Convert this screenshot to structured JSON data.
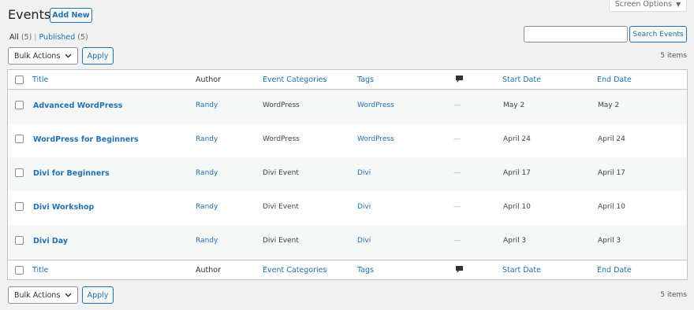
{
  "page": {
    "title": "Events",
    "add_new": "Add New",
    "screen_options": "Screen Options",
    "screen_options_arrow": "▼"
  },
  "views": {
    "all_label": "All",
    "all_count": "(5)",
    "separator": "|",
    "published_label": "Published",
    "published_count": "(5)"
  },
  "search": {
    "value": "",
    "button": "Search Events"
  },
  "bulk": {
    "label": "Bulk Actions",
    "apply": "Apply",
    "items_count": "5 items"
  },
  "columns": {
    "title": "Title",
    "author": "Author",
    "categories": "Event Categories",
    "tags": "Tags",
    "comments_icon": "comment-bubble-icon",
    "start": "Start Date",
    "end": "End Date"
  },
  "rows": [
    {
      "title": "Advanced WordPress",
      "author": "Randy",
      "category": "WordPress",
      "tag": "WordPress",
      "comments": "—",
      "start": "May 2",
      "end": "May 2"
    },
    {
      "title": "WordPress for Beginners",
      "author": "Randy",
      "category": "WordPress",
      "tag": "WordPress",
      "comments": "—",
      "start": "April 24",
      "end": "April 24"
    },
    {
      "title": "Divi for Beginners",
      "author": "Randy",
      "category": "Divi Event",
      "tag": "Divi",
      "comments": "—",
      "start": "April 17",
      "end": "April 17"
    },
    {
      "title": "Divi Workshop",
      "author": "Randy",
      "category": "Divi Event",
      "tag": "Divi",
      "comments": "—",
      "start": "April 10",
      "end": "April 10"
    },
    {
      "title": "Divi Day",
      "author": "Randy",
      "category": "Divi Event",
      "tag": "Divi",
      "comments": "—",
      "start": "April 3",
      "end": "April 3"
    }
  ],
  "colors": {
    "link": "#2271b1",
    "background": "#f1f1f1",
    "alt_row": "#f6f7f7"
  }
}
